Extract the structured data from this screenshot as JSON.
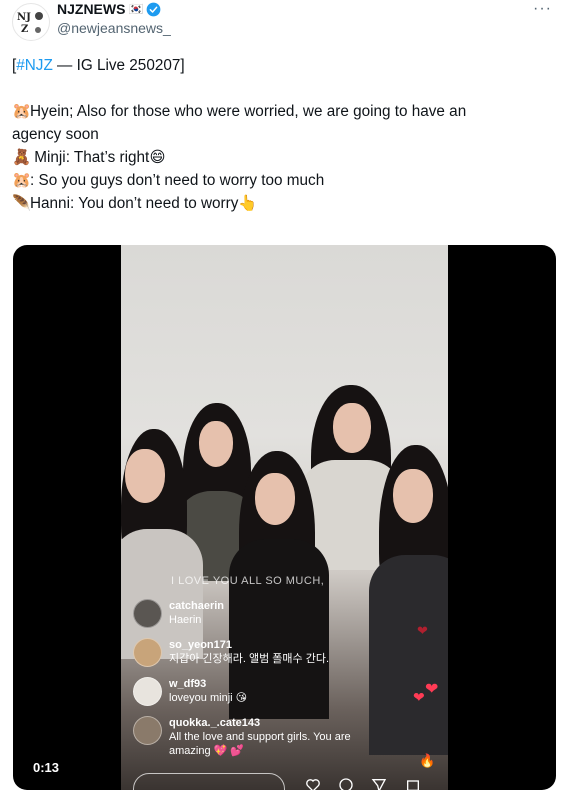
{
  "header": {
    "display_name": "NJZNEWS",
    "flag": "🇰🇷",
    "handle": "@newjeansnews_",
    "more": "···"
  },
  "tweet": {
    "line1_hashtag": "#NJZ",
    "line1_bracket_open": "[",
    "line1_rest": " — IG Live 250207]",
    "line2_emoji": "🐹",
    "line2": "Hyein; Also for those who were worried, we are going to have an",
    "line3": "agency soon",
    "line4_emoji": "🧸",
    "line4": " Minji: That’s right",
    "line4_end_emoji": "😄",
    "line5_emoji": "🐹",
    "line5": ": So you guys don’t need to worry too much",
    "line6_emoji": "🪶",
    "line6": "Hanni: You don’t need to worry",
    "line6_end_emoji": "👆"
  },
  "video": {
    "caption": "I LOVE YOU ALL SO MUCH,",
    "timestamp": "0:13",
    "comments": [
      {
        "user": "catchaerin",
        "text": "Haerin"
      },
      {
        "user": "so_yeon171",
        "text": "지갑아 긴장해라. 앨범 폴매수 간다."
      },
      {
        "user": "w_df93",
        "text": "loveyou minji 😘"
      },
      {
        "user": "quokka._.cate143",
        "text": "All the love and support girls. You are",
        "text2": "amazing 💖 💕"
      }
    ],
    "hearts": [
      "❤",
      "❤",
      "❤"
    ],
    "flame": "🔥"
  },
  "colors": {
    "accent": "#1d9bf0",
    "verified": "#1d9bf0",
    "media_bg": "#000000"
  }
}
